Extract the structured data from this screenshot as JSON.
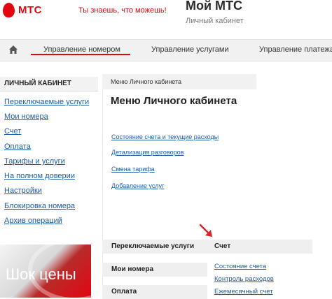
{
  "header": {
    "logo_text": "МТС",
    "slogan": "Ты знаешь, что можешь!",
    "title": "Мой МТС",
    "subtitle": "Личный кабинет",
    "brand_color": "#e30611"
  },
  "nav": {
    "home_icon": "home-icon",
    "tabs": [
      {
        "label": "Управление номером",
        "active": true
      },
      {
        "label": "Управление услугами",
        "active": false
      },
      {
        "label": "Управление платежами",
        "active": false
      }
    ]
  },
  "sidebar": {
    "title": "ЛИЧНЫЙ КАБИНЕТ",
    "items": [
      "Переключаемые услуги",
      "Мои номера",
      "Счет",
      "Оплата",
      "Тарифы и услуги",
      "На полном доверии",
      "Настройки",
      "Блокировка номера",
      "Архив операций"
    ]
  },
  "promo": {
    "text": "Шок цены"
  },
  "main": {
    "breadcrumb": "Меню Личного кабинета",
    "title": "Меню Личного кабинета",
    "links": [
      "Состояние счета и текущие расходы",
      "Детализация разговоров",
      "Смена тарифа",
      "Добавление услуг"
    ],
    "grid": {
      "rows": [
        {
          "left": "Переключаемые услуги",
          "right": "Счет"
        },
        {
          "left": "Мои номера",
          "right": ""
        },
        {
          "left": "Оплата",
          "right": ""
        }
      ],
      "sublinks": [
        "Состояние счета",
        "Контроль расходов",
        "Ежемесячный счет"
      ]
    }
  }
}
